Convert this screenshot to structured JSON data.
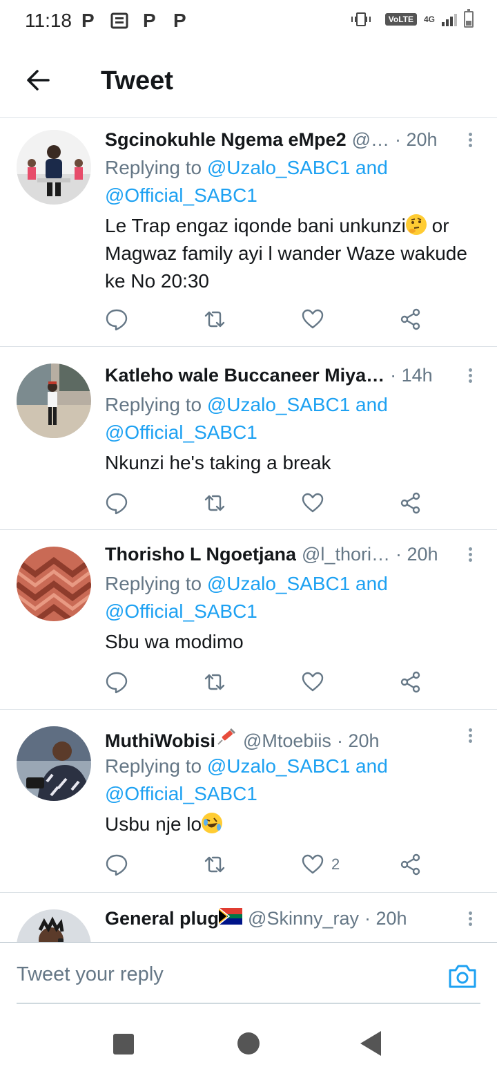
{
  "status_bar": {
    "time": "11:18",
    "notif_1": "P",
    "notif_3": "P",
    "notif_4": "P",
    "volte": "VoLTE",
    "network": "4G"
  },
  "header": {
    "title": "Tweet"
  },
  "tweets": [
    {
      "name": "Sgcinokuhle Ngema eMpe2",
      "handle": "@…",
      "time": "· 20h",
      "reply_prefix": "Replying to ",
      "reply_to_1": "@Uzalo_SABC1 and",
      "reply_to_2": "@Official_SABC1",
      "text_a": "Le Trap engaz iqonde bani unkunzi",
      "text_b": " or Magwaz family ayi l wander  Waze wakude ke No 20:30",
      "emoji": "thinking-emoji",
      "likes": ""
    },
    {
      "name": "Katleho wale Buccaneer Miya…",
      "handle": "",
      "time": "· 14h",
      "reply_prefix": "Replying to ",
      "reply_to_1": "@Uzalo_SABC1 and",
      "reply_to_2": "@Official_SABC1",
      "text_a": "Nkunzi he's taking a break",
      "likes": ""
    },
    {
      "name": "Thorisho L Ngoetjana",
      "handle": "@l_thori…",
      "time": "· 20h",
      "reply_prefix": "Replying to ",
      "reply_to_1": "@Uzalo_SABC1 and",
      "reply_to_2": "@Official_SABC1",
      "text_a": "Sbu wa modimo",
      "likes": ""
    },
    {
      "name": "MuthiWobisi",
      "handle": "@Mtoebiis",
      "time": "· 20h",
      "reply_prefix": "Replying to ",
      "reply_to_1": "@Uzalo_SABC1 and",
      "reply_to_2": "@Official_SABC1",
      "text_a": "Usbu nje lo",
      "emoji": "rolling-laughing-emoji",
      "likes": "2"
    },
    {
      "name": "General plug",
      "handle": "@Skinny_ray",
      "time": "· 20h",
      "flag": "south-africa-flag"
    }
  ],
  "reply_bar": {
    "placeholder": "Tweet your reply"
  },
  "colors": {
    "link": "#1da1f2",
    "muted": "#657786",
    "text": "#14171a",
    "divider": "#dbe1e6"
  }
}
